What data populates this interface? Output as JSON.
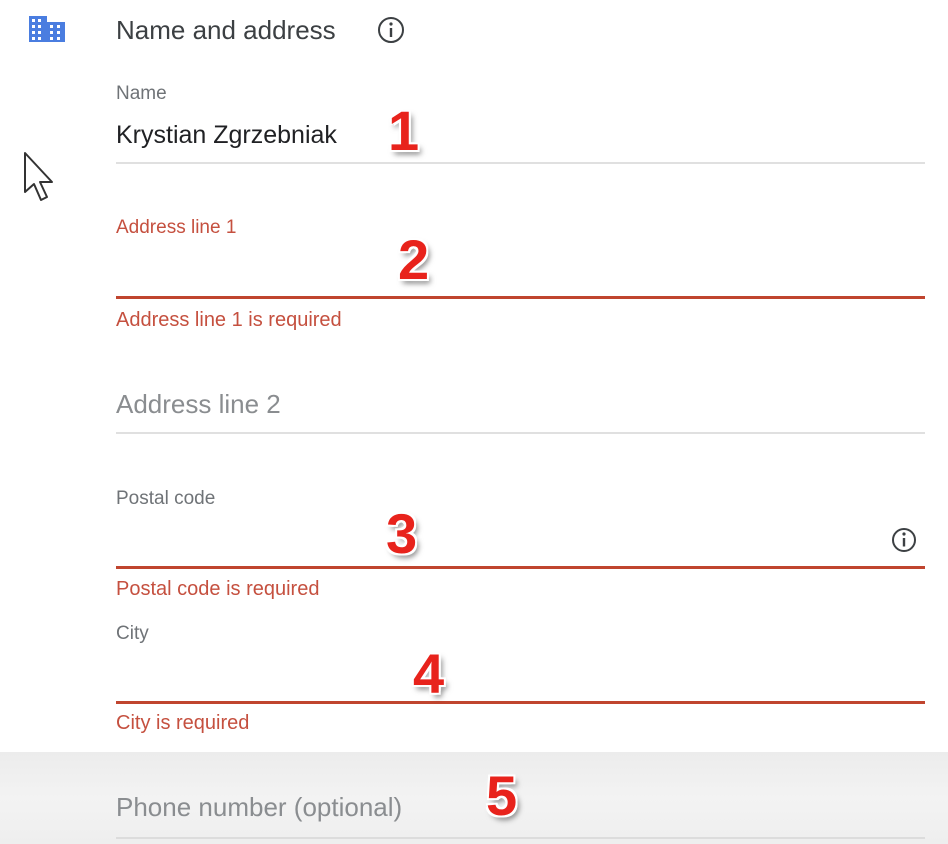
{
  "section": {
    "title": "Name and address",
    "icon": "building-icon",
    "info_icon": "info-icon"
  },
  "fields": {
    "name": {
      "label": "Name",
      "value": "Krystian Zgrzebniak"
    },
    "address1": {
      "label": "Address line 1",
      "value": "",
      "error": "Address line 1 is required"
    },
    "address2": {
      "placeholder": "Address line 2"
    },
    "postal": {
      "label": "Postal code",
      "value": "",
      "error": "Postal code is required",
      "info_icon": "info-icon"
    },
    "city": {
      "label": "City",
      "value": "",
      "error": "City is required"
    },
    "phone": {
      "placeholder": "Phone number (optional)"
    }
  },
  "annotations": [
    "1",
    "2",
    "3",
    "4",
    "5"
  ],
  "colors": {
    "accent_blue": "#4285f4",
    "error_red": "#c5503f",
    "annotation_red": "#e8231c"
  },
  "cursor": "mouse-pointer-icon"
}
